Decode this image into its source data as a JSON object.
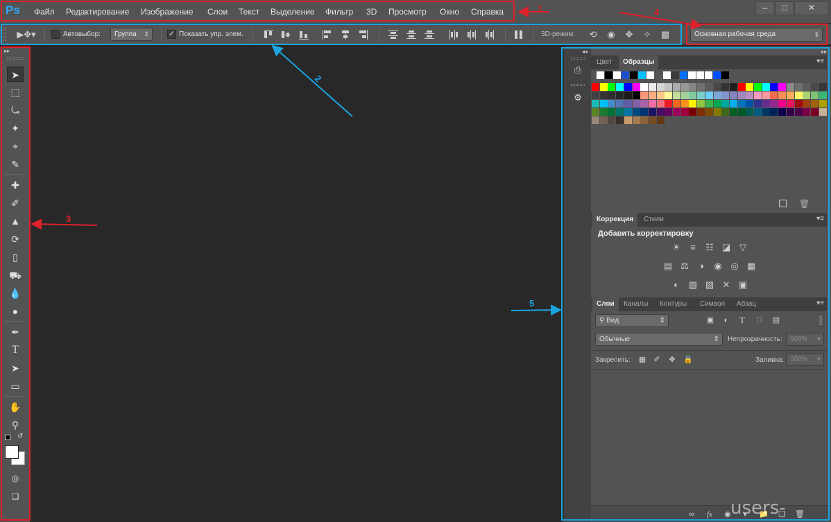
{
  "app": {
    "logo": "Ps"
  },
  "menu": [
    "Файл",
    "Редактирование",
    "Изображение",
    "Слои",
    "Текст",
    "Выделение",
    "Фильтр",
    "3D",
    "Просмотр",
    "Окно",
    "Справка"
  ],
  "window_controls": [
    "minimize-icon",
    "maximize-icon",
    "close-icon"
  ],
  "options_bar": {
    "autoselect_label": "Автовыбор:",
    "autoselect_checked": false,
    "group_value": "Группа",
    "show_transform_label": "Показать упр. элем.",
    "show_transform_checked": true,
    "mode3d_label": "3D-режим:",
    "workspace_value": "Основная рабочая среда"
  },
  "tools": [
    "move-tool",
    "marquee-tool",
    "lasso-tool",
    "magic-wand-tool",
    "crop-tool",
    "eyedropper-tool",
    "healing-brush-tool",
    "brush-tool",
    "clone-stamp-tool",
    "history-brush-tool",
    "eraser-tool",
    "paint-bucket-tool",
    "blur-tool",
    "dodge-tool",
    "pen-tool",
    "type-tool",
    "path-selection-tool",
    "shape-tool",
    "hand-tool",
    "zoom-tool"
  ],
  "swatches_panel": {
    "tabs": [
      "Цвет",
      "Образцы"
    ],
    "active_tab": "Образцы",
    "recent": [
      "#ffffff",
      "#000000",
      "#ffffff",
      "#1e4fd0",
      "#000000",
      "#00bfff",
      "#ffffff",
      "#555555",
      "#ffffff",
      "#3a3a3a",
      "#0070ff",
      "#ffffff",
      "#ffffff",
      "#ffffff",
      "#0050ff",
      "#000000"
    ],
    "rows": [
      [
        "#ff0000",
        "#ffff00",
        "#00ff00",
        "#00ffff",
        "#0000ff",
        "#ff00ff",
        "#ffffff",
        "#ebebeb",
        "#d6d6d6",
        "#c2c2c2",
        "#adadad",
        "#999999",
        "#858585",
        "#707070",
        "#5c5c5c",
        "#474747",
        "#333333",
        "#1f1f1f",
        "#ff0000",
        "#ffff00",
        "#00ff00",
        "#00ffff",
        "#0000ff",
        "#ff00ff",
        "#8a8a8a",
        "#6e6e6e",
        "#5c5c5c",
        "#4a4a4a",
        "#383838"
      ],
      [
        "#404040",
        "#363636",
        "#2d2d2d",
        "#242424",
        "#1a1a1a",
        "#000000",
        "#f7977a",
        "#f9ad81",
        "#fdc68a",
        "#fff79a",
        "#c4df9b",
        "#a3d39c",
        "#82ca9d",
        "#7bcdc8",
        "#6ecff6",
        "#7ea7d8",
        "#8493ca",
        "#8882be",
        "#a187be",
        "#bc8dbf",
        "#f49ac2",
        "#f6989d",
        "#f26c4f",
        "#f68e55",
        "#fbaf5c",
        "#fff467",
        "#acd372",
        "#7cc576",
        "#3bb878"
      ],
      [
        "#1abbb4",
        "#00bff3",
        "#438ccb",
        "#5574b9",
        "#605ca8",
        "#855fa8",
        "#a763a8",
        "#f06ea9",
        "#f26d7d",
        "#ed1c24",
        "#f26522",
        "#f7941d",
        "#fff200",
        "#8dc63f",
        "#39b54a",
        "#00a651",
        "#00a99d",
        "#00aeef",
        "#0072bc",
        "#0054a6",
        "#2e3192",
        "#662d91",
        "#92278f",
        "#ec008c",
        "#ed145b",
        "#9e0b0f",
        "#a0410d",
        "#a36209",
        "#aba000"
      ],
      [
        "#598527",
        "#1a7b30",
        "#007236",
        "#00746b",
        "#0076a3",
        "#004b80",
        "#003471",
        "#1b1464",
        "#440e62",
        "#630460",
        "#9e005d",
        "#9e0039",
        "#790000",
        "#7b2e00",
        "#7d4900",
        "#827b00",
        "#406618",
        "#005e20",
        "#005826",
        "#005952",
        "#005b7f",
        "#003663",
        "#002157",
        "#0d004c",
        "#32004b",
        "#4b0049",
        "#7b0046",
        "#7a0026",
        "#c7b299"
      ],
      [
        "#998675",
        "#736357",
        "#534741",
        "#37302d",
        "#c69c6d",
        "#a67c52",
        "#8c6239",
        "#754c24",
        "#603913"
      ]
    ]
  },
  "adjustments_panel": {
    "tabs": [
      "Коррекция",
      "Стили"
    ],
    "active_tab": "Коррекция",
    "heading": "Добавить корректировку",
    "icons": [
      "brightness-icon",
      "levels-icon",
      "curves-icon",
      "exposure-icon",
      "vibrance-icon",
      "hue-saturation-icon",
      "color-balance-icon",
      "black-white-icon",
      "photo-filter-icon",
      "channel-mixer-icon",
      "color-lookup-icon",
      "invert-icon",
      "posterize-icon",
      "threshold-icon",
      "selective-color-icon",
      "gradient-map-icon"
    ]
  },
  "layers_panel": {
    "tabs": [
      "Слои",
      "Каналы",
      "Контуры",
      "Символ",
      "Абзац"
    ],
    "active_tab": "Слои",
    "filter_value": "Вид",
    "blend_mode": "Обычные",
    "opacity_label": "Непрозрачность:",
    "opacity_value": "100%",
    "lock_label": "Закрепить:",
    "fill_label": "Заливка:",
    "fill_value": "100%"
  },
  "annotations": [
    "1",
    "2",
    "3",
    "4",
    "5"
  ],
  "watermark": "users-pc.ru"
}
